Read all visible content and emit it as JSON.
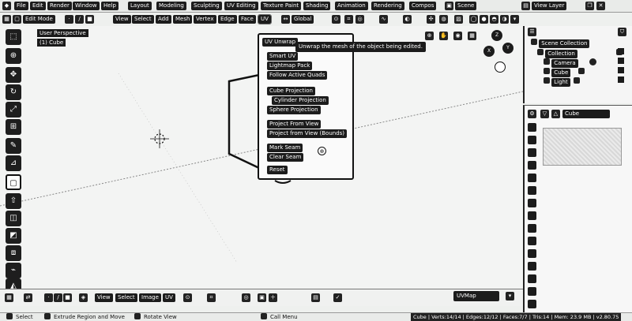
{
  "menubar": {
    "menus": [
      "File",
      "Edit",
      "Render",
      "Window",
      "Help"
    ],
    "workspaces": [
      "Layout",
      "Modeling",
      "Sculpting",
      "UV Editing",
      "Texture Paint",
      "Shading",
      "Animation",
      "Rendering",
      "Compos"
    ],
    "scene_label": "Scene",
    "view_layer_label": "View Layer"
  },
  "viewport_header": {
    "mode": "Edit Mode",
    "menus": [
      "View",
      "Select",
      "Add",
      "Mesh",
      "Vertex",
      "Edge",
      "Face",
      "UV"
    ],
    "transform": "Global"
  },
  "viewport": {
    "perspective": "User Perspective",
    "object": "(1) Cube"
  },
  "uv_menu": {
    "title": "UV Unwrap",
    "items": [
      "Smart UV",
      "Lightmap Pack",
      "Follow Active Quads",
      "Cube Projection",
      "Cylinder Projection",
      "Sphere Projection",
      "Project From View",
      "Project from View (Bounds)",
      "Mark Seam",
      "Clear Seam",
      "Reset"
    ],
    "tooltip": "Unwrap the mesh of the object being edited."
  },
  "bottom_header": {
    "menus": [
      "View",
      "Select",
      "Image",
      "UV"
    ],
    "uvmap": "UVMap"
  },
  "status": {
    "select": "Select",
    "extrude": "Extrude Region and Move",
    "rotate": "Rotate View",
    "call_menu": "Call Menu",
    "stats": "Cube | Verts:14/14 | Edges:12/12 | Faces:7/7 | Tris:14 | Mem: 23.9 MB | v2.80.75"
  },
  "outliner": {
    "title": "Scene Collection",
    "items": [
      "Collection",
      "Camera",
      "Cube",
      "Light"
    ]
  },
  "properties": {
    "object_name": "Cube"
  },
  "colors": {
    "ui_dark": "#1c1c1c",
    "viewport_bg": "#f3f4f3"
  }
}
